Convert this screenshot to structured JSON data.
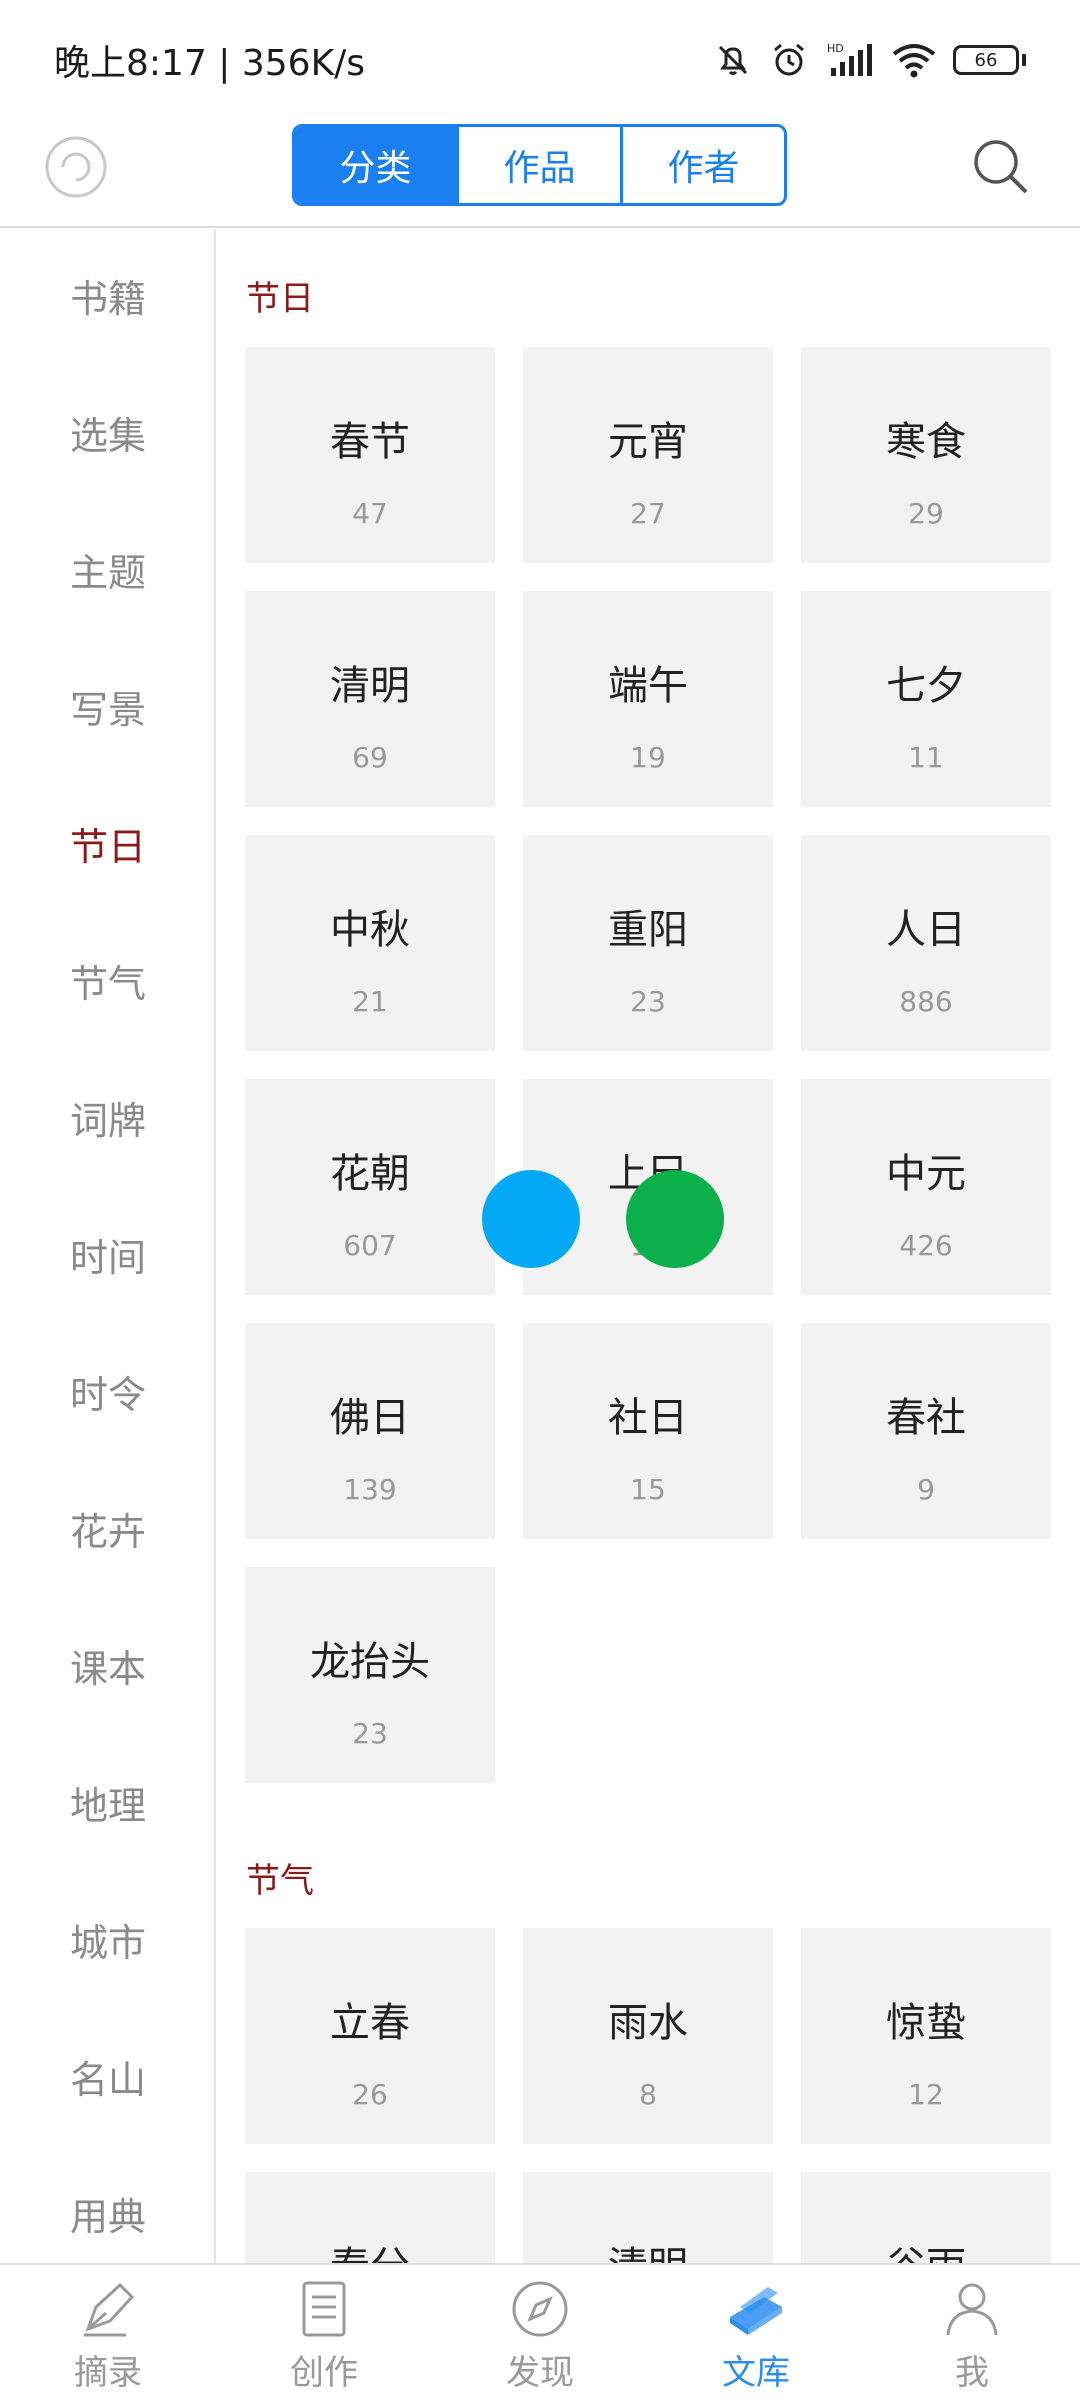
{
  "status_bar": {
    "time_speed": "晚上8:17 | 356K/s",
    "battery": "66"
  },
  "top_nav": {
    "tabs": [
      {
        "label": "分类",
        "active": true
      },
      {
        "label": "作品",
        "active": false
      },
      {
        "label": "作者",
        "active": false
      }
    ],
    "accent_color": "#1a7ff0"
  },
  "sidebar": {
    "items": [
      {
        "label": "书籍",
        "active": false
      },
      {
        "label": "选集",
        "active": false
      },
      {
        "label": "主题",
        "active": false
      },
      {
        "label": "写景",
        "active": false
      },
      {
        "label": "节日",
        "active": true
      },
      {
        "label": "节气",
        "active": false
      },
      {
        "label": "词牌",
        "active": false
      },
      {
        "label": "时间",
        "active": false
      },
      {
        "label": "时令",
        "active": false
      },
      {
        "label": "花卉",
        "active": false
      },
      {
        "label": "课本",
        "active": false
      },
      {
        "label": "地理",
        "active": false
      },
      {
        "label": "城市",
        "active": false
      },
      {
        "label": "名山",
        "active": false
      },
      {
        "label": "用典",
        "active": false
      }
    ],
    "active_color": "#8b1a1a"
  },
  "sections": [
    {
      "title": "节日",
      "cards": [
        {
          "name": "春节",
          "count": "47"
        },
        {
          "name": "元宵",
          "count": "27"
        },
        {
          "name": "寒食",
          "count": "29"
        },
        {
          "name": "清明",
          "count": "69"
        },
        {
          "name": "端午",
          "count": "19"
        },
        {
          "name": "七夕",
          "count": "11"
        },
        {
          "name": "中秋",
          "count": "21"
        },
        {
          "name": "重阳",
          "count": "23"
        },
        {
          "name": "人日",
          "count": "886"
        },
        {
          "name": "花朝",
          "count": "607"
        },
        {
          "name": "上巳",
          "count": "12"
        },
        {
          "name": "中元",
          "count": "426"
        },
        {
          "name": "佛日",
          "count": "139"
        },
        {
          "name": "社日",
          "count": "15"
        },
        {
          "name": "春社",
          "count": "9"
        },
        {
          "name": "龙抬头",
          "count": "23"
        }
      ]
    },
    {
      "title": "节气",
      "cards": [
        {
          "name": "立春",
          "count": "26"
        },
        {
          "name": "雨水",
          "count": "8"
        },
        {
          "name": "惊蛰",
          "count": "12"
        },
        {
          "name": "春分",
          "count": ""
        },
        {
          "name": "清明",
          "count": ""
        },
        {
          "name": "谷雨",
          "count": ""
        }
      ]
    }
  ],
  "touch_indicators": [
    {
      "color": "#03a9f4"
    },
    {
      "color": "#0bb04a"
    }
  ],
  "bottom_nav": {
    "items": [
      {
        "label": "摘录",
        "icon": "pen-icon",
        "active": false
      },
      {
        "label": "创作",
        "icon": "document-icon",
        "active": false
      },
      {
        "label": "发现",
        "icon": "compass-icon",
        "active": false
      },
      {
        "label": "文库",
        "icon": "books-icon",
        "active": true
      },
      {
        "label": "我",
        "icon": "person-icon",
        "active": false
      }
    ],
    "active_color": "#2a8df0"
  }
}
